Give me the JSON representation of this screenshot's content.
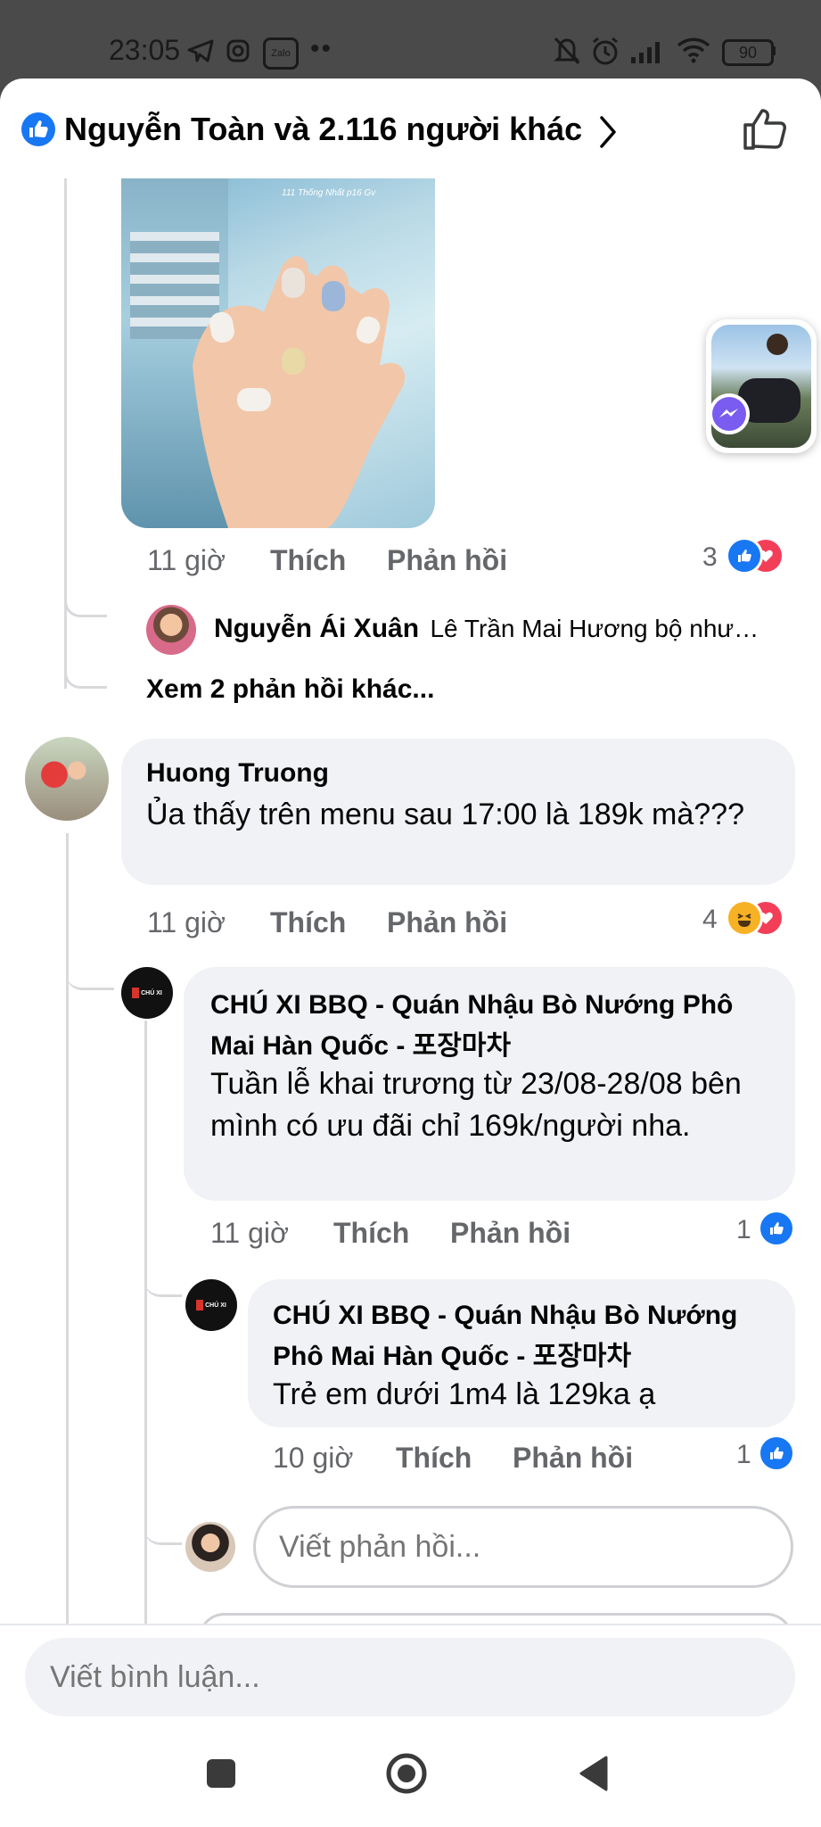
{
  "status_bar": {
    "time": "23:05",
    "zalo_label": "Zalo",
    "battery": "90"
  },
  "header": {
    "title": "Nguyễn Toàn và 2.116 người khác"
  },
  "comment_photo": {
    "nail_caption_line1": "111 Thống Nhất p16 Gv"
  },
  "reply_meta_1": {
    "time": "11 giờ",
    "like": "Thích",
    "reply": "Phản hồi",
    "reaction_count": "3"
  },
  "nested_preview": {
    "author": "Nguyễn Ái Xuân",
    "text": "Lê Trần Mai Hương bộ như…"
  },
  "more_replies": "Xem 2 phản hồi khác...",
  "comment_main": {
    "author": "Huong Truong",
    "text": "Ủa thấy trên menu sau 17:00 là 189k mà???",
    "time": "11 giờ",
    "like": "Thích",
    "reply": "Phản hồi",
    "reaction_count": "4"
  },
  "reply_page_1": {
    "author": "CHÚ XI BBQ - Quán Nhậu Bò Nướng Phô Mai Hàn Quốc - 포장마차",
    "text": "Tuần lễ khai trương từ 23/08-28/08 bên mình có ưu đãi chỉ 169k/người nha.",
    "time": "11 giờ",
    "like": "Thích",
    "reply": "Phản hồi",
    "reaction_count": "1",
    "logo_text": "CHÚ XI"
  },
  "reply_page_2": {
    "author": "CHÚ XI BBQ - Quán Nhậu Bò Nướng Phô Mai Hàn Quốc - 포장마차",
    "text": "Trẻ em dưới 1m4 là 129ka ạ",
    "time": "10 giờ",
    "like": "Thích",
    "reply": "Phản hồi",
    "reaction_count": "1",
    "logo_text": "CHÚ XI"
  },
  "reply_input": {
    "placeholder": "Viết phản hồi..."
  },
  "comment_input": {
    "placeholder": "Viết bình luận..."
  },
  "colors": {
    "like_blue": "#1877f2",
    "love_red": "#f33e58",
    "haha_yellow": "#f7b125",
    "text_secondary": "#65676b",
    "bubble_bg": "#f0f2f5"
  },
  "icons": [
    "like-badge-icon",
    "chevron-right-icon",
    "thumbs-up-icon",
    "messenger-icon",
    "like-reaction-icon",
    "love-reaction-icon",
    "haha-reaction-icon",
    "nav-recents-icon",
    "nav-home-icon",
    "nav-back-icon"
  ]
}
